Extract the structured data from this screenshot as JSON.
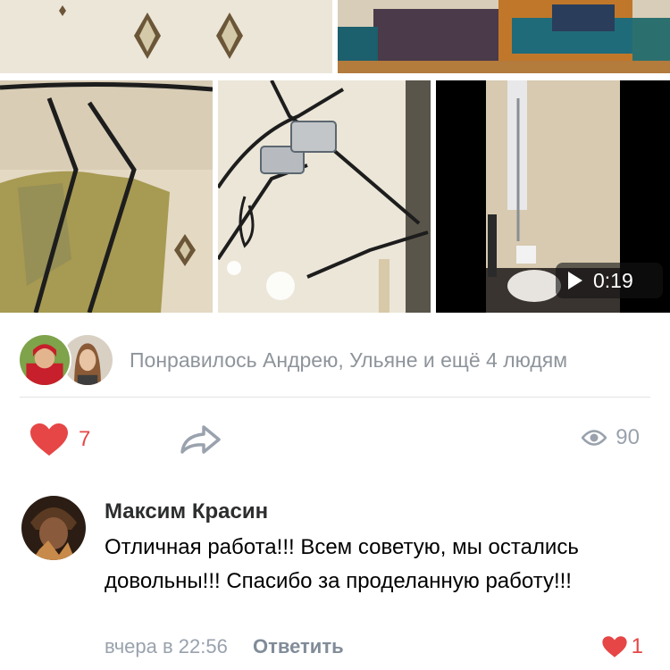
{
  "video": {
    "duration": "0:19"
  },
  "likes_summary": {
    "text": "Понравилось Андрею, Ульяне и ещё 4 людям"
  },
  "actions": {
    "like_count": "7",
    "view_count": "90"
  },
  "comment": {
    "author": "Максим Красин",
    "text": "Отличная работа!!! Всем советую, мы остались довольны!!! Спасибо за проделанную работу!!!",
    "time": "вчера в 22:56",
    "reply_label": "Ответить",
    "like_count": "1"
  },
  "colors": {
    "like_red": "#e64646",
    "muted_gray": "#99a2ad",
    "divider": "#dfe3e6"
  },
  "icons": [
    "heart-icon",
    "share-icon",
    "eye-icon",
    "play-icon"
  ]
}
